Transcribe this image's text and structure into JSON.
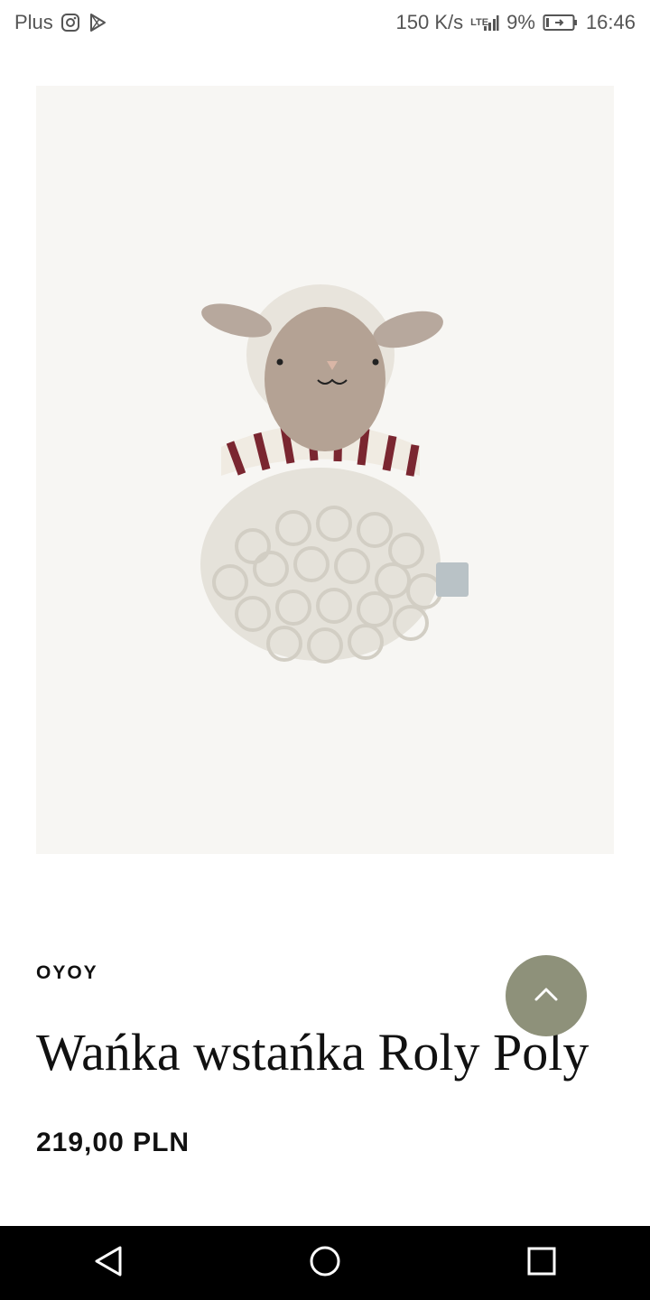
{
  "status_bar": {
    "carrier": "Plus",
    "speed": "150 K/s",
    "network_type": "LTE",
    "battery": "9%",
    "time": "16:46",
    "icons": [
      "instagram-icon",
      "play-store-icon",
      "signal-icon",
      "battery-charging-icon"
    ]
  },
  "product": {
    "image_subject": "knitted sheep roly poly toy",
    "brand": "OYOY",
    "title": "Wańka wstańka Roly Poly",
    "price": "219,00 PLN"
  },
  "scroll_top": {
    "icon": "chevron-up-icon",
    "color": "#8e917a"
  },
  "nav_bar": {
    "icons": [
      "back-icon",
      "home-icon",
      "recents-icon"
    ]
  },
  "colors": {
    "image_bg": "#f7f6f3",
    "accent": "#8e917a"
  }
}
